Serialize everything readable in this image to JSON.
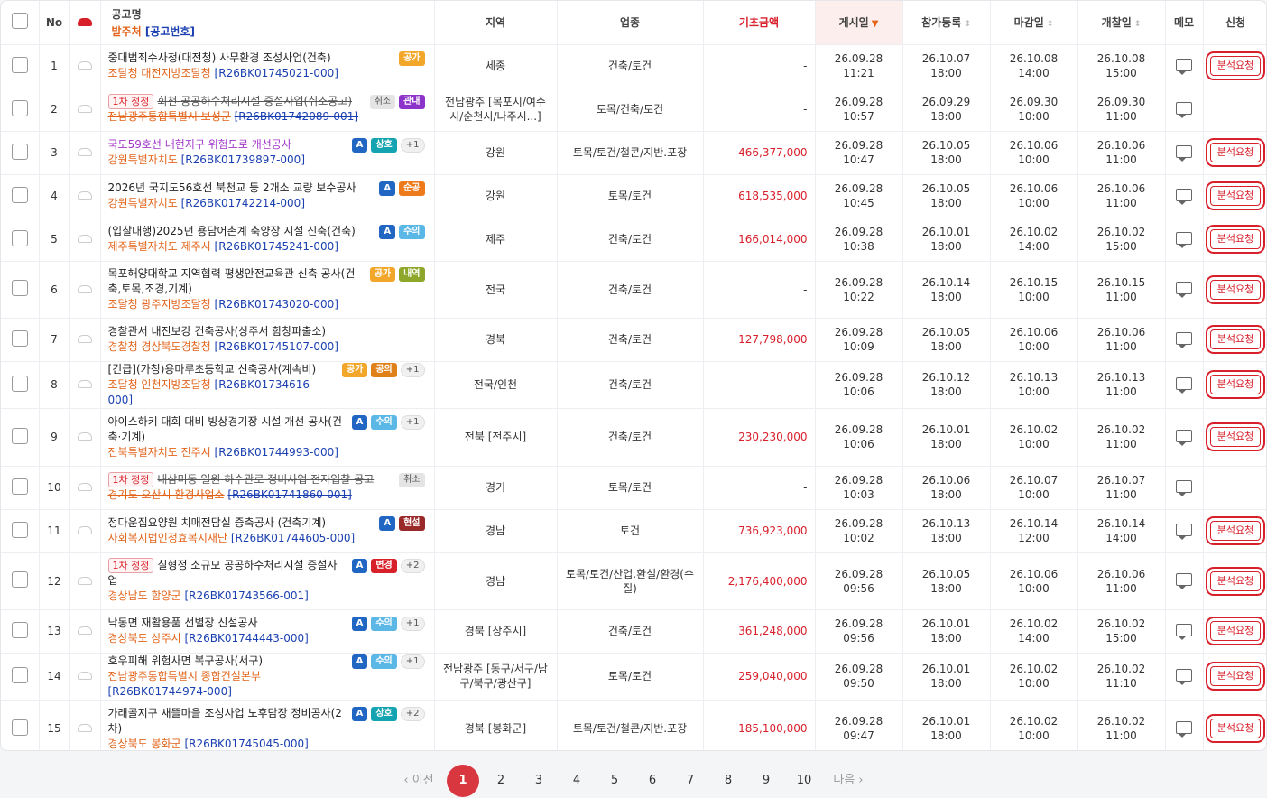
{
  "header": {
    "no": "No",
    "title": "공고명",
    "issuer": "발주처",
    "bid_no": "[공고번호]",
    "region": "지역",
    "category": "업종",
    "base_amount": "기초금액",
    "posted": "게시일",
    "registration": "참가등록",
    "deadline": "마감일",
    "opening": "개찰일",
    "memo": "메모",
    "apply": "신청",
    "sort_active": "▼",
    "sort_idle": "↕"
  },
  "analysis_label": "분석요청",
  "first_correction": "1차 정정",
  "rows": [
    {
      "no": "1",
      "title": "중대범죄수사청(대전청) 사무환경 조성사업(건축)",
      "agency": "조달청 대전지방조달청",
      "code": "[R26BK01745021-000]",
      "badges": [
        {
          "t": "공가",
          "c": "gong"
        }
      ],
      "region": "세종",
      "cat": "건축/토건",
      "amount": "-",
      "posted": [
        "26.09.28",
        "11:21"
      ],
      "reg": [
        "26.10.07",
        "18:00"
      ],
      "dead": [
        "26.10.08",
        "14:00"
      ],
      "open": [
        "26.10.08",
        "15:00"
      ],
      "req": true
    },
    {
      "no": "2",
      "title": "회천 공공하수처리시설 증설사업(취소공고)",
      "agency": "전남광주통합특별시 보성군",
      "code": "[R26BK01742089-001]",
      "badges": [
        {
          "t": "취소",
          "c": "chwi"
        },
        {
          "t": "관내",
          "c": "gwan"
        }
      ],
      "region": "전남광주 [목포시/여수시/순천시/나주시...]",
      "cat": "토목/건축/토건",
      "amount": "-",
      "posted": [
        "26.09.28",
        "10:57"
      ],
      "reg": [
        "26.09.29",
        "18:00"
      ],
      "dead": [
        "26.09.30",
        "10:00"
      ],
      "open": [
        "26.09.30",
        "11:00"
      ],
      "req": false,
      "cancel": true,
      "tag": true
    },
    {
      "no": "3",
      "title": "국도59호선 내현지구 위험도로 개선공사",
      "agency": "강원특별자치도",
      "code": "[R26BK01739897-000]",
      "badges": [
        {
          "t": "A",
          "c": "A"
        },
        {
          "t": "상호",
          "c": "sang"
        },
        {
          "t": "+1",
          "c": "plus"
        }
      ],
      "region": "강원",
      "cat": "토목/토건/철콘/지반.포장",
      "amount": "466,377,000",
      "posted": [
        "26.09.28",
        "10:47"
      ],
      "reg": [
        "26.10.05",
        "18:00"
      ],
      "dead": [
        "26.10.06",
        "10:00"
      ],
      "open": [
        "26.10.06",
        "11:00"
      ],
      "req": true,
      "purple": true
    },
    {
      "no": "4",
      "title": "2026년 국지도56호선 북천교 등 2개소 교량 보수공사",
      "agency": "강원특별자치도",
      "code": "[R26BK01742214-000]",
      "badges": [
        {
          "t": "A",
          "c": "A"
        },
        {
          "t": "순공",
          "c": "sungong"
        }
      ],
      "region": "강원",
      "cat": "토목/토건",
      "amount": "618,535,000",
      "posted": [
        "26.09.28",
        "10:45"
      ],
      "reg": [
        "26.10.05",
        "18:00"
      ],
      "dead": [
        "26.10.06",
        "10:00"
      ],
      "open": [
        "26.10.06",
        "11:00"
      ],
      "req": true
    },
    {
      "no": "5",
      "title": "(입찰대행)2025년 용담어촌계 축양장 시설 신축(건축)",
      "agency": "제주특별자치도 제주시",
      "code": "[R26BK01745241-000]",
      "badges": [
        {
          "t": "A",
          "c": "A"
        },
        {
          "t": "수의",
          "c": "suui"
        }
      ],
      "region": "제주",
      "cat": "건축/토건",
      "amount": "166,014,000",
      "posted": [
        "26.09.28",
        "10:38"
      ],
      "reg": [
        "26.10.01",
        "18:00"
      ],
      "dead": [
        "26.10.02",
        "14:00"
      ],
      "open": [
        "26.10.02",
        "15:00"
      ],
      "req": true
    },
    {
      "no": "6",
      "title": "목포해양대학교 지역협력 평생안전교육관 신축 공사(건축,토목,조경,기계)",
      "agency": "조달청 광주지방조달청",
      "code": "[R26BK01743020-000]",
      "badges": [
        {
          "t": "공가",
          "c": "gong"
        },
        {
          "t": "내역",
          "c": "naeyeok"
        }
      ],
      "region": "전국",
      "cat": "건축/토건",
      "amount": "-",
      "posted": [
        "26.09.28",
        "10:22"
      ],
      "reg": [
        "26.10.14",
        "18:00"
      ],
      "dead": [
        "26.10.15",
        "10:00"
      ],
      "open": [
        "26.10.15",
        "11:00"
      ],
      "req": true
    },
    {
      "no": "7",
      "title": "경찰관서 내진보강 건축공사(상주서 함창파출소)",
      "agency": "경찰청 경상북도경찰청",
      "code": "[R26BK01745107-000]",
      "badges": [],
      "region": "경북",
      "cat": "건축/토건",
      "amount": "127,798,000",
      "posted": [
        "26.09.28",
        "10:09"
      ],
      "reg": [
        "26.10.05",
        "18:00"
      ],
      "dead": [
        "26.10.06",
        "10:00"
      ],
      "open": [
        "26.10.06",
        "11:00"
      ],
      "req": true
    },
    {
      "no": "8",
      "title": "[긴급](가칭)용마루초등학교 신축공사(계속비)",
      "agency": "조달청 인천지방조달청",
      "code": "[R26BK01734616-000]",
      "badges": [
        {
          "t": "공가",
          "c": "gong"
        },
        {
          "t": "공의",
          "c": "gongui"
        },
        {
          "t": "+1",
          "c": "plus"
        }
      ],
      "region": "전국/인천",
      "cat": "건축/토건",
      "amount": "-",
      "posted": [
        "26.09.28",
        "10:06"
      ],
      "reg": [
        "26.10.12",
        "18:00"
      ],
      "dead": [
        "26.10.13",
        "10:00"
      ],
      "open": [
        "26.10.13",
        "11:00"
      ],
      "req": true
    },
    {
      "no": "9",
      "title": "아이스하키 대회 대비 빙상경기장 시설 개선 공사(건축·기계)",
      "agency": "전북특별자치도 전주시",
      "code": "[R26BK01744993-000]",
      "badges": [
        {
          "t": "A",
          "c": "A"
        },
        {
          "t": "수의",
          "c": "suui"
        },
        {
          "t": "+1",
          "c": "plus"
        }
      ],
      "region": "전북 [전주시]",
      "cat": "건축/토건",
      "amount": "230,230,000",
      "posted": [
        "26.09.28",
        "10:06"
      ],
      "reg": [
        "26.10.01",
        "18:00"
      ],
      "dead": [
        "26.10.02",
        "10:00"
      ],
      "open": [
        "26.10.02",
        "11:00"
      ],
      "req": true
    },
    {
      "no": "10",
      "title": "내삼미동 일원 하수관로 정비사업 전자입찰 공고",
      "agency": "경기도 오산시 환경사업소",
      "code": "[R26BK01741860-001]",
      "badges": [
        {
          "t": "취소",
          "c": "chwi"
        }
      ],
      "region": "경기",
      "cat": "토목/토건",
      "amount": "-",
      "posted": [
        "26.09.28",
        "10:03"
      ],
      "reg": [
        "26.10.06",
        "18:00"
      ],
      "dead": [
        "26.10.07",
        "10:00"
      ],
      "open": [
        "26.10.07",
        "11:00"
      ],
      "req": false,
      "cancel": true,
      "tag": true
    },
    {
      "no": "11",
      "title": "정다운집요양원 치매전담실 증축공사 (건축기계)",
      "agency": "사회복지법인정효복지재단",
      "code": "[R26BK01744605-000]",
      "badges": [
        {
          "t": "A",
          "c": "A"
        },
        {
          "t": "현설",
          "c": "hyunsul"
        }
      ],
      "region": "경남",
      "cat": "토건",
      "amount": "736,923,000",
      "posted": [
        "26.09.28",
        "10:02"
      ],
      "reg": [
        "26.10.13",
        "18:00"
      ],
      "dead": [
        "26.10.14",
        "12:00"
      ],
      "open": [
        "26.10.14",
        "14:00"
      ],
      "req": true
    },
    {
      "no": "12",
      "title": "칠형정 소규모 공공하수처리시설 증설사업",
      "agency": "경상남도 함양군",
      "code": "[R26BK01743566-001]",
      "badges": [
        {
          "t": "A",
          "c": "A"
        },
        {
          "t": "변경",
          "c": "byeon"
        },
        {
          "t": "+2",
          "c": "plus"
        }
      ],
      "region": "경남",
      "cat": "토목/토건/산업.환설/환경(수질)",
      "amount": "2,176,400,000",
      "posted": [
        "26.09.28",
        "09:56"
      ],
      "reg": [
        "26.10.05",
        "18:00"
      ],
      "dead": [
        "26.10.06",
        "10:00"
      ],
      "open": [
        "26.10.06",
        "11:00"
      ],
      "req": true,
      "tag": true
    },
    {
      "no": "13",
      "title": "낙동면 재활용품 선별장 신설공사",
      "agency": "경상북도 상주시",
      "code": "[R26BK01744443-000]",
      "badges": [
        {
          "t": "A",
          "c": "A"
        },
        {
          "t": "수의",
          "c": "suui"
        },
        {
          "t": "+1",
          "c": "plus"
        }
      ],
      "region": "경북 [상주시]",
      "cat": "건축/토건",
      "amount": "361,248,000",
      "posted": [
        "26.09.28",
        "09:56"
      ],
      "reg": [
        "26.10.01",
        "18:00"
      ],
      "dead": [
        "26.10.02",
        "14:00"
      ],
      "open": [
        "26.10.02",
        "15:00"
      ],
      "req": true
    },
    {
      "no": "14",
      "title": "호우피해 위험사면 복구공사(서구)",
      "agency": "전남광주통합특별시 종합건설본부",
      "code": "[R26BK01744974-000]",
      "badges": [
        {
          "t": "A",
          "c": "A"
        },
        {
          "t": "수의",
          "c": "suui"
        },
        {
          "t": "+1",
          "c": "plus"
        }
      ],
      "region": "전남광주 [동구/서구/남구/북구/광산구]",
      "cat": "토목/토건",
      "amount": "259,040,000",
      "posted": [
        "26.09.28",
        "09:50"
      ],
      "reg": [
        "26.10.01",
        "18:00"
      ],
      "dead": [
        "26.10.02",
        "10:00"
      ],
      "open": [
        "26.10.02",
        "11:10"
      ],
      "req": true
    },
    {
      "no": "15",
      "title": "가래골지구 새뜰마을 조성사업 노후담장 정비공사(2차)",
      "agency": "경상북도 봉화군",
      "code": "[R26BK01745045-000]",
      "badges": [
        {
          "t": "A",
          "c": "A"
        },
        {
          "t": "상호",
          "c": "sang"
        },
        {
          "t": "+2",
          "c": "plus"
        }
      ],
      "region": "경북 [봉화군]",
      "cat": "토목/토건/철콘/지반.포장",
      "amount": "185,100,000",
      "posted": [
        "26.09.28",
        "09:47"
      ],
      "reg": [
        "26.10.01",
        "18:00"
      ],
      "dead": [
        "26.10.02",
        "10:00"
      ],
      "open": [
        "26.10.02",
        "11:00"
      ],
      "req": true
    }
  ],
  "pagination": {
    "prev": "‹ 이전",
    "next": "다음 ›",
    "pages": [
      "1",
      "2",
      "3",
      "4",
      "5",
      "6",
      "7",
      "8",
      "9",
      "10"
    ],
    "current": "1"
  }
}
